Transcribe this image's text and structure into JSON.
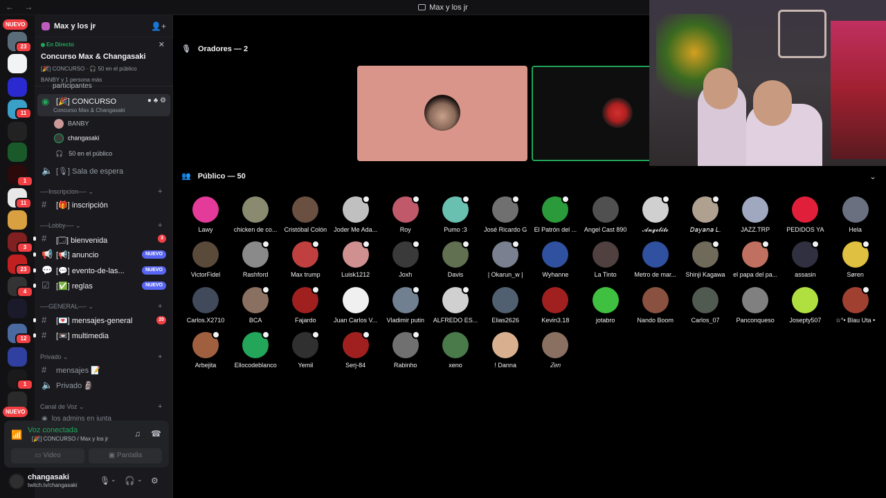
{
  "window": {
    "title": "Max y los jr",
    "nav": "← →"
  },
  "server": {
    "name": "Max y los jr"
  },
  "rail": {
    "nuevo_top": "NUEVO",
    "nuevo_bottom": "NUEVO",
    "badges": [
      "23",
      "11",
      "1",
      "11",
      "3",
      "23",
      "4",
      "12",
      "1"
    ]
  },
  "live": {
    "status": "En Directo",
    "event": "Concurso Max & Changasaki",
    "channel_info": "[🎉] CONCURSO · 🎧 50 en el público",
    "people": "BANBY y 1 persona más"
  },
  "channels": {
    "partial_top": "participantes",
    "concurso": {
      "label": "[🎉] CONCURSO",
      "sub": "Concurso Max & Changasaki"
    },
    "stage_members": [
      "BANBY",
      "changasaki"
    ],
    "audience_count": "50 en el público",
    "sala": "[🎙] Sala de espera",
    "cat_inscripcion": "—-Inscripcion—-",
    "inscripcion": "[🎁] inscripción",
    "cat_lobby": "—-Lobby—-",
    "bienvenida": {
      "label": "[🗔] bienvenida",
      "count": "3"
    },
    "anuncio": {
      "label": "[📢] anuncio",
      "badge": "NUEVO"
    },
    "evento": {
      "label": "[💬] evento-de-las...",
      "badge": "NUEVO"
    },
    "reglas": {
      "label": "[✅] reglas",
      "badge": "NUEVO"
    },
    "cat_general": "—-GENERAL—-",
    "mensajes_general": {
      "label": "[💌] mensajes-general",
      "count": "20"
    },
    "multimedia": "[📼] multimedia",
    "cat_privado": "Privado",
    "mensajes": "mensajes 📝",
    "privado": "Privado 🗿",
    "cat_voz": "Canal de Voz",
    "admins": "los admins en junta"
  },
  "voice": {
    "status": "Voz conectada",
    "channel": "[🎉] CONCURSO / Max y los jr",
    "video_label": "Video",
    "screen_label": "Pantalla"
  },
  "user": {
    "name": "changasaki",
    "status": "twitch.tv/changasaki"
  },
  "stage": {
    "speakers_label": "Oradores — 2",
    "audience_label": "Público — 50"
  },
  "audience": [
    "Lawy",
    "chicken de co...",
    "Cristóbal Colón",
    "Joder Me Ada...",
    "Roy",
    "Pumo :3",
    "José Ricardo G",
    "El Patrón del ...",
    "Angel Cast 890",
    "𝓐𝓷𝓰𝓮𝓵𝓲𝓽𝓸",
    "𝘋𝘢𝘺𝘢𝘯𝘢 𝘓.",
    "JAZZ.TRP",
    "PEDIDOS YA",
    "Hela",
    "VictorFidel",
    "Rashford",
    "Max trump",
    "Luisk1212",
    "Joxh",
    "Davis",
    "| Okarun_w |",
    "Wyhanne",
    "La Tinto",
    "Metro de mar...",
    "Shinji Kagawa",
    "el papa del pa...",
    "assasin",
    "Søren",
    "Carlos.X2710",
    "BCA",
    "Fajardo",
    "Juan Carlos V...",
    "Vladimir putin",
    "ALFREDO ES...",
    "Elias2626",
    "Kevin3.18",
    "jotabro",
    "Nando Boom",
    "Carlos_07",
    "Panconqueso",
    "Josepty507",
    "☆°• Blau Uta •",
    "Arbejita",
    "Ellocodeblanco",
    "Yemil",
    "Serj-84",
    "Rabinho",
    "xeno",
    "! Danna",
    "𝑍𝑒𝑛"
  ],
  "colors": {
    "online": "#23a55a",
    "badge_red": "#f23f43",
    "blurple": "#5865f2",
    "speaker_bg": "#d9958a"
  }
}
